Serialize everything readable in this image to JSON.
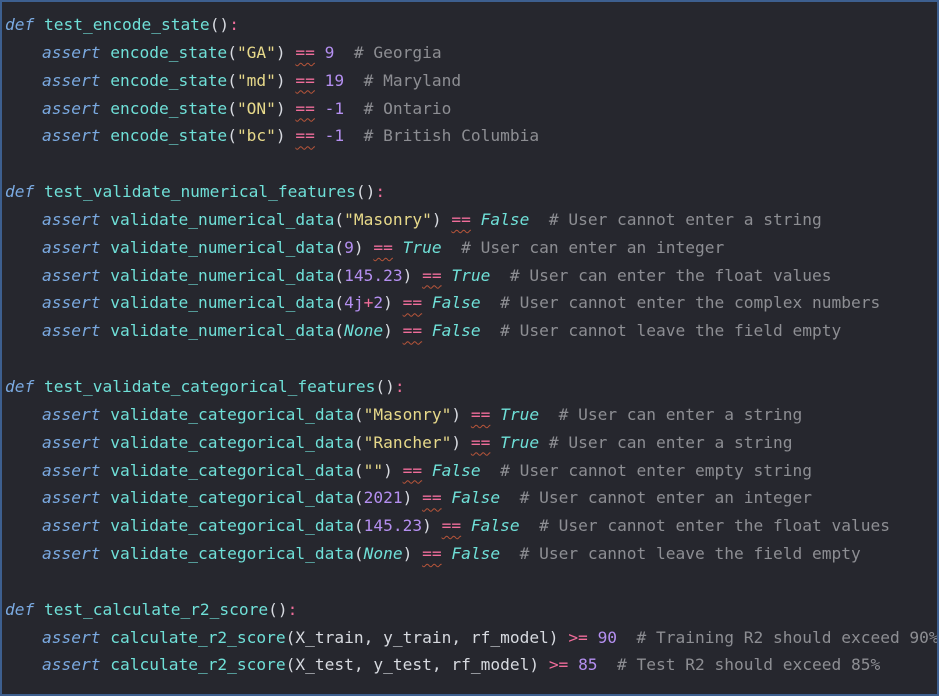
{
  "editor": {
    "lines": [
      {
        "indent": false,
        "tokens": [
          {
            "t": "def",
            "c": "kw"
          },
          {
            "t": " ",
            "c": "pun"
          },
          {
            "t": "test_encode_state",
            "c": "fn"
          },
          {
            "t": "()",
            "c": "pun"
          },
          {
            "t": ":",
            "c": "colon"
          }
        ]
      },
      {
        "indent": true,
        "tokens": [
          {
            "t": "assert",
            "c": "kw"
          },
          {
            "t": " ",
            "c": "pun"
          },
          {
            "t": "encode_state",
            "c": "fn"
          },
          {
            "t": "(",
            "c": "pun"
          },
          {
            "t": "\"GA\"",
            "c": "str"
          },
          {
            "t": ")",
            "c": "pun"
          },
          {
            "t": " ",
            "c": "pun"
          },
          {
            "t": "==",
            "c": "op",
            "s": true
          },
          {
            "t": " ",
            "c": "pun"
          },
          {
            "t": "9",
            "c": "num"
          },
          {
            "t": "  # Georgia",
            "c": "cmt"
          }
        ]
      },
      {
        "indent": true,
        "tokens": [
          {
            "t": "assert",
            "c": "kw"
          },
          {
            "t": " ",
            "c": "pun"
          },
          {
            "t": "encode_state",
            "c": "fn"
          },
          {
            "t": "(",
            "c": "pun"
          },
          {
            "t": "\"md\"",
            "c": "str"
          },
          {
            "t": ")",
            "c": "pun"
          },
          {
            "t": " ",
            "c": "pun"
          },
          {
            "t": "==",
            "c": "op",
            "s": true
          },
          {
            "t": " ",
            "c": "pun"
          },
          {
            "t": "19",
            "c": "num"
          },
          {
            "t": "  # Maryland",
            "c": "cmt"
          }
        ]
      },
      {
        "indent": true,
        "tokens": [
          {
            "t": "assert",
            "c": "kw"
          },
          {
            "t": " ",
            "c": "pun"
          },
          {
            "t": "encode_state",
            "c": "fn"
          },
          {
            "t": "(",
            "c": "pun"
          },
          {
            "t": "\"ON\"",
            "c": "str"
          },
          {
            "t": ")",
            "c": "pun"
          },
          {
            "t": " ",
            "c": "pun"
          },
          {
            "t": "==",
            "c": "op",
            "s": true
          },
          {
            "t": " ",
            "c": "pun"
          },
          {
            "t": "-1",
            "c": "num"
          },
          {
            "t": "  # Ontario",
            "c": "cmt"
          }
        ]
      },
      {
        "indent": true,
        "tokens": [
          {
            "t": "assert",
            "c": "kw"
          },
          {
            "t": " ",
            "c": "pun"
          },
          {
            "t": "encode_state",
            "c": "fn"
          },
          {
            "t": "(",
            "c": "pun"
          },
          {
            "t": "\"bc\"",
            "c": "str"
          },
          {
            "t": ")",
            "c": "pun"
          },
          {
            "t": " ",
            "c": "pun"
          },
          {
            "t": "==",
            "c": "op",
            "s": true
          },
          {
            "t": " ",
            "c": "pun"
          },
          {
            "t": "-1",
            "c": "num"
          },
          {
            "t": "  # British Columbia",
            "c": "cmt"
          }
        ]
      },
      {
        "indent": false,
        "tokens": []
      },
      {
        "indent": false,
        "tokens": [
          {
            "t": "def",
            "c": "kw"
          },
          {
            "t": " ",
            "c": "pun"
          },
          {
            "t": "test_validate_numerical_features",
            "c": "fn"
          },
          {
            "t": "()",
            "c": "pun"
          },
          {
            "t": ":",
            "c": "colon"
          }
        ]
      },
      {
        "indent": true,
        "tokens": [
          {
            "t": "assert",
            "c": "kw"
          },
          {
            "t": " ",
            "c": "pun"
          },
          {
            "t": "validate_numerical_data",
            "c": "fn"
          },
          {
            "t": "(",
            "c": "pun"
          },
          {
            "t": "\"Masonry\"",
            "c": "str"
          },
          {
            "t": ")",
            "c": "pun"
          },
          {
            "t": " ",
            "c": "pun"
          },
          {
            "t": "==",
            "c": "op",
            "s": true
          },
          {
            "t": " ",
            "c": "pun"
          },
          {
            "t": "False",
            "c": "const"
          },
          {
            "t": "  # User cannot enter a string",
            "c": "cmt"
          }
        ]
      },
      {
        "indent": true,
        "tokens": [
          {
            "t": "assert",
            "c": "kw"
          },
          {
            "t": " ",
            "c": "pun"
          },
          {
            "t": "validate_numerical_data",
            "c": "fn"
          },
          {
            "t": "(",
            "c": "pun"
          },
          {
            "t": "9",
            "c": "num"
          },
          {
            "t": ")",
            "c": "pun"
          },
          {
            "t": " ",
            "c": "pun"
          },
          {
            "t": "==",
            "c": "op",
            "s": true
          },
          {
            "t": " ",
            "c": "pun"
          },
          {
            "t": "True",
            "c": "const"
          },
          {
            "t": "  # User can enter an integer",
            "c": "cmt"
          }
        ]
      },
      {
        "indent": true,
        "tokens": [
          {
            "t": "assert",
            "c": "kw"
          },
          {
            "t": " ",
            "c": "pun"
          },
          {
            "t": "validate_numerical_data",
            "c": "fn"
          },
          {
            "t": "(",
            "c": "pun"
          },
          {
            "t": "145.23",
            "c": "num"
          },
          {
            "t": ")",
            "c": "pun"
          },
          {
            "t": " ",
            "c": "pun"
          },
          {
            "t": "==",
            "c": "op",
            "s": true
          },
          {
            "t": " ",
            "c": "pun"
          },
          {
            "t": "True",
            "c": "const"
          },
          {
            "t": "  # User can enter the float values",
            "c": "cmt"
          }
        ]
      },
      {
        "indent": true,
        "tokens": [
          {
            "t": "assert",
            "c": "kw"
          },
          {
            "t": " ",
            "c": "pun"
          },
          {
            "t": "validate_numerical_data",
            "c": "fn"
          },
          {
            "t": "(",
            "c": "pun"
          },
          {
            "t": "4j",
            "c": "num"
          },
          {
            "t": "+",
            "c": "op"
          },
          {
            "t": "2",
            "c": "num"
          },
          {
            "t": ")",
            "c": "pun"
          },
          {
            "t": " ",
            "c": "pun"
          },
          {
            "t": "==",
            "c": "op",
            "s": true
          },
          {
            "t": " ",
            "c": "pun"
          },
          {
            "t": "False",
            "c": "const"
          },
          {
            "t": "  # User cannot enter the complex numbers",
            "c": "cmt"
          }
        ]
      },
      {
        "indent": true,
        "tokens": [
          {
            "t": "assert",
            "c": "kw"
          },
          {
            "t": " ",
            "c": "pun"
          },
          {
            "t": "validate_numerical_data",
            "c": "fn"
          },
          {
            "t": "(",
            "c": "pun"
          },
          {
            "t": "None",
            "c": "const"
          },
          {
            "t": ")",
            "c": "pun"
          },
          {
            "t": " ",
            "c": "pun"
          },
          {
            "t": "==",
            "c": "op",
            "s": true
          },
          {
            "t": " ",
            "c": "pun"
          },
          {
            "t": "False",
            "c": "const"
          },
          {
            "t": "  # User cannot leave the field empty",
            "c": "cmt"
          }
        ]
      },
      {
        "indent": false,
        "tokens": []
      },
      {
        "indent": false,
        "tokens": [
          {
            "t": "def",
            "c": "kw"
          },
          {
            "t": " ",
            "c": "pun"
          },
          {
            "t": "test_validate_categorical_features",
            "c": "fn"
          },
          {
            "t": "()",
            "c": "pun"
          },
          {
            "t": ":",
            "c": "colon"
          }
        ]
      },
      {
        "indent": true,
        "tokens": [
          {
            "t": "assert",
            "c": "kw"
          },
          {
            "t": " ",
            "c": "pun"
          },
          {
            "t": "validate_categorical_data",
            "c": "fn"
          },
          {
            "t": "(",
            "c": "pun"
          },
          {
            "t": "\"Masonry\"",
            "c": "str"
          },
          {
            "t": ")",
            "c": "pun"
          },
          {
            "t": " ",
            "c": "pun"
          },
          {
            "t": "==",
            "c": "op",
            "s": true
          },
          {
            "t": " ",
            "c": "pun"
          },
          {
            "t": "True",
            "c": "const"
          },
          {
            "t": "  # User can enter a string",
            "c": "cmt"
          }
        ]
      },
      {
        "indent": true,
        "tokens": [
          {
            "t": "assert",
            "c": "kw"
          },
          {
            "t": " ",
            "c": "pun"
          },
          {
            "t": "validate_categorical_data",
            "c": "fn"
          },
          {
            "t": "(",
            "c": "pun"
          },
          {
            "t": "\"Rancher\"",
            "c": "str"
          },
          {
            "t": ")",
            "c": "pun"
          },
          {
            "t": " ",
            "c": "pun"
          },
          {
            "t": "==",
            "c": "op",
            "s": true
          },
          {
            "t": " ",
            "c": "pun"
          },
          {
            "t": "True",
            "c": "const"
          },
          {
            "t": " # User can enter a string",
            "c": "cmt"
          }
        ]
      },
      {
        "indent": true,
        "tokens": [
          {
            "t": "assert",
            "c": "kw"
          },
          {
            "t": " ",
            "c": "pun"
          },
          {
            "t": "validate_categorical_data",
            "c": "fn"
          },
          {
            "t": "(",
            "c": "pun"
          },
          {
            "t": "\"\"",
            "c": "str"
          },
          {
            "t": ")",
            "c": "pun"
          },
          {
            "t": " ",
            "c": "pun"
          },
          {
            "t": "==",
            "c": "op",
            "s": true
          },
          {
            "t": " ",
            "c": "pun"
          },
          {
            "t": "False",
            "c": "const"
          },
          {
            "t": "  # User cannot enter empty string",
            "c": "cmt"
          }
        ]
      },
      {
        "indent": true,
        "tokens": [
          {
            "t": "assert",
            "c": "kw"
          },
          {
            "t": " ",
            "c": "pun"
          },
          {
            "t": "validate_categorical_data",
            "c": "fn"
          },
          {
            "t": "(",
            "c": "pun"
          },
          {
            "t": "2021",
            "c": "num"
          },
          {
            "t": ")",
            "c": "pun"
          },
          {
            "t": " ",
            "c": "pun"
          },
          {
            "t": "==",
            "c": "op",
            "s": true
          },
          {
            "t": " ",
            "c": "pun"
          },
          {
            "t": "False",
            "c": "const"
          },
          {
            "t": "  # User cannot enter an integer",
            "c": "cmt"
          }
        ]
      },
      {
        "indent": true,
        "tokens": [
          {
            "t": "assert",
            "c": "kw"
          },
          {
            "t": " ",
            "c": "pun"
          },
          {
            "t": "validate_categorical_data",
            "c": "fn"
          },
          {
            "t": "(",
            "c": "pun"
          },
          {
            "t": "145.23",
            "c": "num"
          },
          {
            "t": ")",
            "c": "pun"
          },
          {
            "t": " ",
            "c": "pun"
          },
          {
            "t": "==",
            "c": "op",
            "s": true
          },
          {
            "t": " ",
            "c": "pun"
          },
          {
            "t": "False",
            "c": "const"
          },
          {
            "t": "  # User cannot enter the float values",
            "c": "cmt"
          }
        ]
      },
      {
        "indent": true,
        "tokens": [
          {
            "t": "assert",
            "c": "kw"
          },
          {
            "t": " ",
            "c": "pun"
          },
          {
            "t": "validate_categorical_data",
            "c": "fn"
          },
          {
            "t": "(",
            "c": "pun"
          },
          {
            "t": "None",
            "c": "const"
          },
          {
            "t": ")",
            "c": "pun"
          },
          {
            "t": " ",
            "c": "pun"
          },
          {
            "t": "==",
            "c": "op",
            "s": true
          },
          {
            "t": " ",
            "c": "pun"
          },
          {
            "t": "False",
            "c": "const"
          },
          {
            "t": "  # User cannot leave the field empty",
            "c": "cmt"
          }
        ]
      },
      {
        "indent": false,
        "tokens": []
      },
      {
        "indent": false,
        "tokens": [
          {
            "t": "def",
            "c": "kw"
          },
          {
            "t": " ",
            "c": "pun"
          },
          {
            "t": "test_calculate_r2_score",
            "c": "fn"
          },
          {
            "t": "()",
            "c": "pun"
          },
          {
            "t": ":",
            "c": "colon"
          }
        ]
      },
      {
        "indent": true,
        "tokens": [
          {
            "t": "assert",
            "c": "kw"
          },
          {
            "t": " ",
            "c": "pun"
          },
          {
            "t": "calculate_r2_score",
            "c": "fn"
          },
          {
            "t": "(X_train, y_train, rf_model)",
            "c": "pun"
          },
          {
            "t": " ",
            "c": "pun"
          },
          {
            "t": ">=",
            "c": "op"
          },
          {
            "t": " ",
            "c": "pun"
          },
          {
            "t": "90",
            "c": "num"
          },
          {
            "t": "  # Training R2 should exceed 90%",
            "c": "cmt"
          }
        ]
      },
      {
        "indent": true,
        "tokens": [
          {
            "t": "assert",
            "c": "kw"
          },
          {
            "t": " ",
            "c": "pun"
          },
          {
            "t": "calculate_r2_score",
            "c": "fn"
          },
          {
            "t": "(X_test, y_test, rf_model)",
            "c": "pun"
          },
          {
            "t": " ",
            "c": "pun"
          },
          {
            "t": ">=",
            "c": "op"
          },
          {
            "t": " ",
            "c": "pun"
          },
          {
            "t": "85",
            "c": "num"
          },
          {
            "t": "  # Test R2 should exceed 85%",
            "c": "cmt"
          }
        ]
      }
    ]
  }
}
